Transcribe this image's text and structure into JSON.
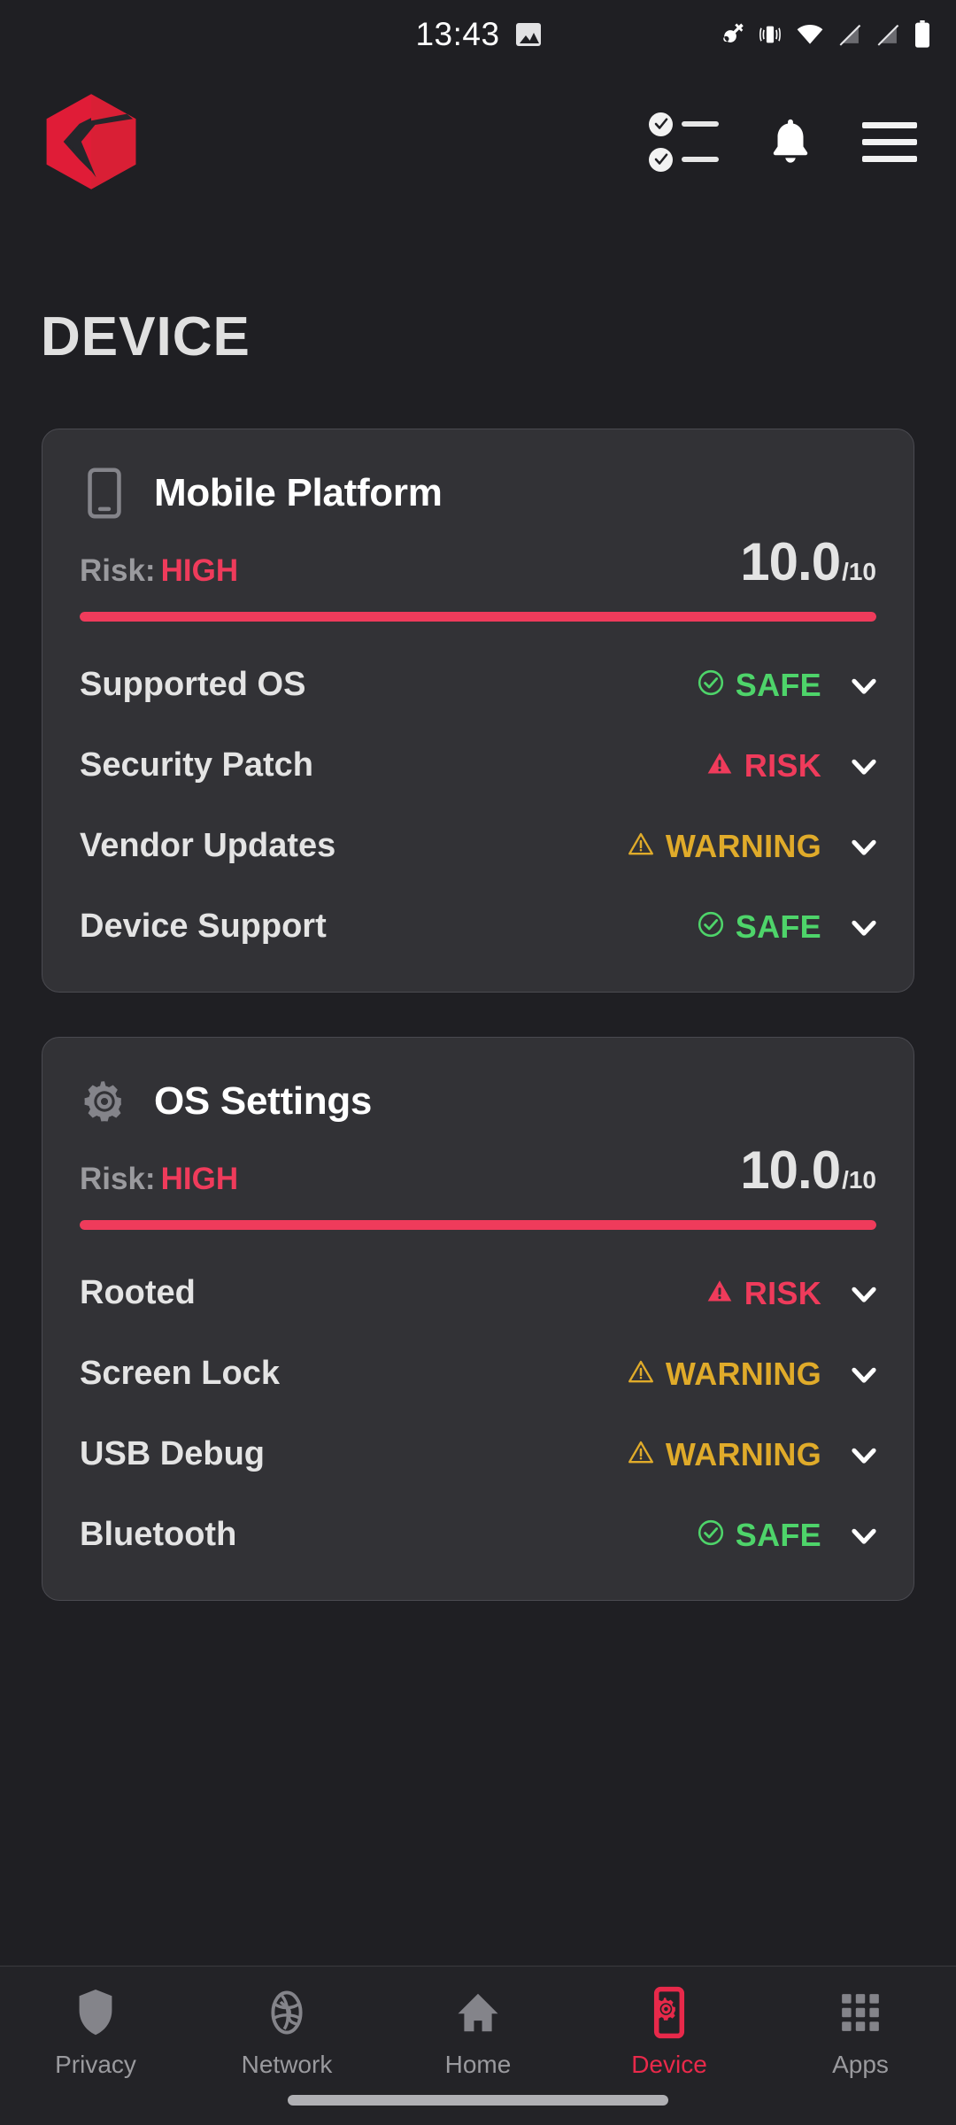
{
  "statusbar": {
    "time": "13:43",
    "left_icons": [
      "photo-icon"
    ],
    "right_icons": [
      "vpn-key-icon",
      "vibrate-icon",
      "wifi-icon",
      "signal-off-icon",
      "signal-off-icon",
      "battery-icon"
    ]
  },
  "header": {
    "logo_name": "app-logo",
    "actions": [
      {
        "name": "checklist-icon",
        "label": "Checklist"
      },
      {
        "name": "bell-icon",
        "label": "Notifications"
      },
      {
        "name": "hamburger-menu-icon",
        "label": "Menu"
      }
    ]
  },
  "page": {
    "title": "DEVICE"
  },
  "colors": {
    "accent_red": "#e8294a",
    "risk_red": "#ef3b5b",
    "safe_green": "#4ed46a",
    "warning_yellow": "#e0ab2a",
    "page_bg": "#1f1f23",
    "card_bg": "#323236",
    "muted_text": "#9a9a9e"
  },
  "cards": [
    {
      "icon": "mobile-phone-icon",
      "title": "Mobile Platform",
      "risk_label": "Risk:",
      "risk_value": "HIGH",
      "risk_color": "#ef3b5b",
      "score": "10.0",
      "score_max": "/10",
      "progress_percent": 100,
      "progress_color": "#ef3b5b",
      "rows": [
        {
          "label": "Supported OS",
          "status": "SAFE",
          "status_color": "#4ed46a",
          "status_icon": "check-circle-icon"
        },
        {
          "label": "Security Patch",
          "status": "RISK",
          "status_color": "#ef3b5b",
          "status_icon": "warning-triangle-filled-icon"
        },
        {
          "label": "Vendor Updates",
          "status": "WARNING",
          "status_color": "#e0ab2a",
          "status_icon": "warning-triangle-outline-icon"
        },
        {
          "label": "Device Support",
          "status": "SAFE",
          "status_color": "#4ed46a",
          "status_icon": "check-circle-icon"
        }
      ]
    },
    {
      "icon": "gear-icon",
      "title": "OS Settings",
      "risk_label": "Risk:",
      "risk_value": "HIGH",
      "risk_color": "#ef3b5b",
      "score": "10.0",
      "score_max": "/10",
      "progress_percent": 100,
      "progress_color": "#ef3b5b",
      "rows": [
        {
          "label": "Rooted",
          "status": "RISK",
          "status_color": "#ef3b5b",
          "status_icon": "warning-triangle-filled-icon"
        },
        {
          "label": "Screen Lock",
          "status": "WARNING",
          "status_color": "#e0ab2a",
          "status_icon": "warning-triangle-outline-icon"
        },
        {
          "label": "USB Debug",
          "status": "WARNING",
          "status_color": "#e0ab2a",
          "status_icon": "warning-triangle-outline-icon"
        },
        {
          "label": "Bluetooth",
          "status": "SAFE",
          "status_color": "#4ed46a",
          "status_icon": "check-circle-icon"
        }
      ]
    }
  ],
  "bottom_nav": {
    "items": [
      {
        "label": "Privacy",
        "icon": "shield-icon",
        "active": false
      },
      {
        "label": "Network",
        "icon": "globe-icon",
        "active": false
      },
      {
        "label": "Home",
        "icon": "home-icon",
        "active": false
      },
      {
        "label": "Device",
        "icon": "device-gear-icon",
        "active": true
      },
      {
        "label": "Apps",
        "icon": "grid-apps-icon",
        "active": false
      }
    ]
  }
}
